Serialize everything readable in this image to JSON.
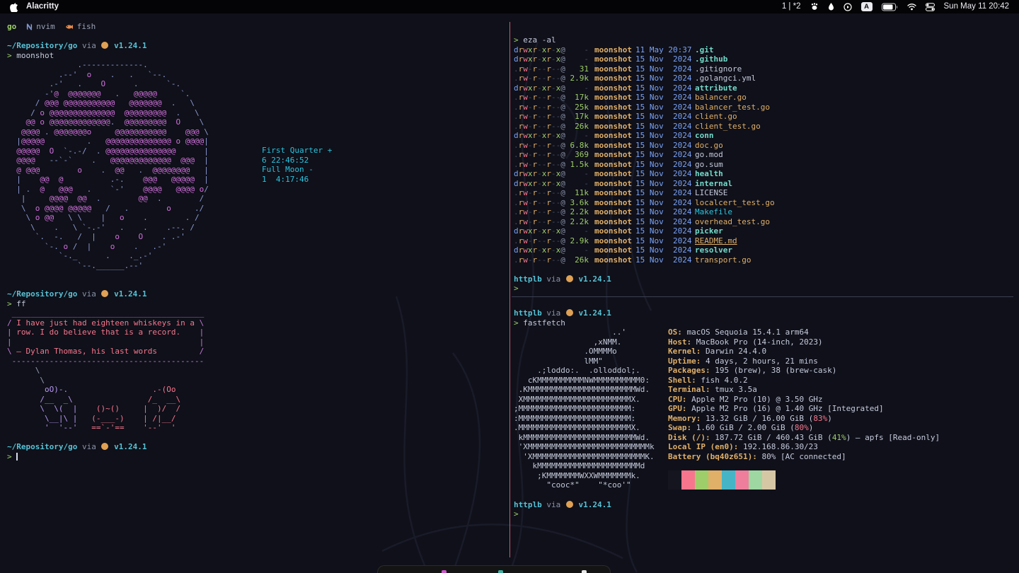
{
  "menubar": {
    "app_name": "Alacritty",
    "spaces_indicator": "1 | *2",
    "input_source": "A",
    "clock": "Sun May 11 20:42"
  },
  "tmux": {
    "windows": [
      {
        "label": "go",
        "active": true
      },
      {
        "label": "nvim",
        "active": false
      },
      {
        "label": "fish",
        "active": false
      }
    ]
  },
  "prompt": {
    "left_path": "~/Repository/go",
    "right_path": "httplb",
    "via": "via",
    "go_version": "v1.24.1",
    "symbol": ">"
  },
  "left_pane": {
    "cmd_moonshot": "moonshot",
    "moon_art": [
      "               .-------------.",
      "           .--'  o    .   .   `--.",
      "         .-'   .    O      .      `-.",
      "        -'@  @@@@@@@   .   @@@@@     `.",
      "      / @@@ @@@@@@@@@@@   @@@@@@@  .   \\",
      "     / o @@@@@@@@@@@@@@  @@@@@@@@@  .   \\",
      "    @@ o @@@@@@@@@@@@@.  @@@@@@@@@  O    \\",
      "   @@@@ . @@@@@@@o     @@@@@@@@@@@    @@@ \\",
      "  |@@@@@         .   @@@@@@@@@@@@@@ o @@@@|",
      "  @@@@@  O  `-.-/  . @@@@@@@@@@@@@@@      |",
      "  @@@@   --`-`    .   @@@@@@@@@@@@@  @@@  |",
      "  @ @@@        o    .  @@   .  @@@@@@@@   |",
      "  |    @@  @          .-.    @@@   @@@@@  |",
      "  | .  @   @@@   .    `-'    @@@@   @@@@ o/",
      "   |     @@@@  @@  .        @@  .        /",
      "   \\  o @@@@ @@@@@   /   .        o     ./",
      "    \\ o @@   \\ \\    |   o    .        . /",
      "     \\    .   \\ `-.-'   .    .    .--. /",
      "      `.  -.   /  |    o    O    . .-'",
      "        `-. o /  |    o    .   .-'",
      "           `-._      .    ._.-'",
      "               `--.______.--'"
    ],
    "moon_info": [
      "First Quarter +",
      "6 22:46:52",
      "Full Moon -",
      "1  4:17:46"
    ],
    "cmd_ff": "ff",
    "fortune": [
      " _________________________________________",
      "/ I have just had eighteen whiskeys in a \\",
      "| row. I do believe that is a record.    |",
      "|                                        |",
      "\\ — Dylan Thomas, his last words         /",
      " -----------------------------------------"
    ],
    "animal_art": [
      "      \\",
      "       \\",
      "        oO)-.                  .-(Oo",
      "       /__  _\\                /_  __\\",
      "       \\  \\(  |    ()~()     |  )/  /",
      "        \\__|\\ |   (-___-)    | /|__/",
      "        '  '--'   ==`-'==    '--'  '"
    ]
  },
  "right_top": {
    "cmd": "eza -al",
    "files": [
      {
        "perm": "drwxr-xr-x@",
        "size": "-",
        "user": "moonshot",
        "date": "11 May 20:37",
        "name": ".git",
        "type": "dir"
      },
      {
        "perm": "drwxr-xr-x@",
        "size": "-",
        "user": "moonshot",
        "date": "15 Nov  2024",
        "name": ".github",
        "type": "dir"
      },
      {
        "perm": ".rw-r--r--@",
        "size": "31",
        "user": "moonshot",
        "date": "15 Nov  2024",
        "name": ".gitignore",
        "type": "plain"
      },
      {
        "perm": ".rw-r--r--@",
        "size": "2.9k",
        "user": "moonshot",
        "date": "15 Nov  2024",
        "name": ".golangci.yml",
        "type": "plain"
      },
      {
        "perm": "drwxr-xr-x@",
        "size": "-",
        "user": "moonshot",
        "date": "15 Nov  2024",
        "name": "attribute",
        "type": "dir"
      },
      {
        "perm": ".rw-r--r--@",
        "size": "17k",
        "user": "moonshot",
        "date": "15 Nov  2024",
        "name": "balancer.go",
        "type": "go"
      },
      {
        "perm": ".rw-r--r--@",
        "size": "25k",
        "user": "moonshot",
        "date": "15 Nov  2024",
        "name": "balancer_test.go",
        "type": "go"
      },
      {
        "perm": ".rw-r--r--@",
        "size": "17k",
        "user": "moonshot",
        "date": "15 Nov  2024",
        "name": "client.go",
        "type": "go"
      },
      {
        "perm": ".rw-r--r--@",
        "size": "26k",
        "user": "moonshot",
        "date": "15 Nov  2024",
        "name": "client_test.go",
        "type": "go"
      },
      {
        "perm": "drwxr-xr-x@",
        "size": "-",
        "user": "moonshot",
        "date": "15 Nov  2024",
        "name": "conn",
        "type": "dir"
      },
      {
        "perm": ".rw-r--r--@",
        "size": "6.8k",
        "user": "moonshot",
        "date": "15 Nov  2024",
        "name": "doc.go",
        "type": "go"
      },
      {
        "perm": ".rw-r--r--@",
        "size": "369",
        "user": "moonshot",
        "date": "15 Nov  2024",
        "name": "go.mod",
        "type": "plain"
      },
      {
        "perm": ".rw-r--r--@",
        "size": "1.5k",
        "user": "moonshot",
        "date": "15 Nov  2024",
        "name": "go.sum",
        "type": "plain"
      },
      {
        "perm": "drwxr-xr-x@",
        "size": "-",
        "user": "moonshot",
        "date": "15 Nov  2024",
        "name": "health",
        "type": "dir"
      },
      {
        "perm": "drwxr-xr-x@",
        "size": "-",
        "user": "moonshot",
        "date": "15 Nov  2024",
        "name": "internal",
        "type": "dir"
      },
      {
        "perm": ".rw-r--r--@",
        "size": "11k",
        "user": "moonshot",
        "date": "15 Nov  2024",
        "name": "LICENSE",
        "type": "plain"
      },
      {
        "perm": ".rw-r--r--@",
        "size": "3.6k",
        "user": "moonshot",
        "date": "15 Nov  2024",
        "name": "localcert_test.go",
        "type": "go"
      },
      {
        "perm": ".rw-r--r--@",
        "size": "2.2k",
        "user": "moonshot",
        "date": "15 Nov  2024",
        "name": "Makefile",
        "type": "make"
      },
      {
        "perm": ".rw-r--r--@",
        "size": "2.2k",
        "user": "moonshot",
        "date": "15 Nov  2024",
        "name": "overhead_test.go",
        "type": "go"
      },
      {
        "perm": "drwxr-xr-x@",
        "size": "-",
        "user": "moonshot",
        "date": "15 Nov  2024",
        "name": "picker",
        "type": "dir"
      },
      {
        "perm": ".rw-r--r--@",
        "size": "2.9k",
        "user": "moonshot",
        "date": "15 Nov  2024",
        "name": "README.md",
        "type": "readme"
      },
      {
        "perm": "drwxr-xr-x@",
        "size": "-",
        "user": "moonshot",
        "date": "15 Nov  2024",
        "name": "resolver",
        "type": "dir"
      },
      {
        "perm": ".rw-r--r--@",
        "size": "26k",
        "user": "moonshot",
        "date": "15 Nov  2024",
        "name": "transport.go",
        "type": "go"
      }
    ]
  },
  "right_bottom": {
    "cmd": "fastfetch",
    "logo": [
      "                     ..'",
      "                 ,xNMM.",
      "               .OMMMMo",
      "               lMM\"",
      "     .;loddo:.  .olloddol;.",
      "   cKMMMMMMMMMMNWMMMMMMMMMM0:",
      " .KMMMMMMMMMMMMMMMMMMMMMMMWd.",
      " XMMMMMMMMMMMMMMMMMMMMMMMX.",
      ";MMMMMMMMMMMMMMMMMMMMMMMM:",
      ":MMMMMMMMMMMMMMMMMMMMMMMM:",
      ".MMMMMMMMMMMMMMMMMMMMMMMMX.",
      " kMMMMMMMMMMMMMMMMMMMMMMMMWd.",
      " 'XMMMMMMMMMMMMMMMMMMMMMMMMMMk",
      "  'XMMMMMMMMMMMMMMMMMMMMMMMMK.",
      "    kMMMMMMMMMMMMMMMMMMMMMMd",
      "     ;KMMMMMMMWXXWMMMMMMMk.",
      "       \"cooc*\"    \"*coo'\""
    ],
    "info": [
      {
        "label": "OS",
        "parts": [
          {
            "t": "macOS Sequoia 15.4.1 arm64"
          }
        ]
      },
      {
        "label": "Host",
        "parts": [
          {
            "t": "MacBook Pro (14-inch, 2023)"
          }
        ]
      },
      {
        "label": "Kernel",
        "parts": [
          {
            "t": "Darwin 24.4.0"
          }
        ]
      },
      {
        "label": "Uptime",
        "parts": [
          {
            "t": "4 days, 2 hours, 21 mins"
          }
        ]
      },
      {
        "label": "Packages",
        "parts": [
          {
            "t": "195 (brew), 38 (brew-cask)"
          }
        ]
      },
      {
        "label": "Shell",
        "parts": [
          {
            "t": "fish 4.0.2"
          }
        ]
      },
      {
        "label": "Terminal",
        "parts": [
          {
            "t": "tmux 3.5a"
          }
        ]
      },
      {
        "label": "CPU",
        "parts": [
          {
            "t": "Apple M2 Pro (10) @ 3.50 GHz"
          }
        ]
      },
      {
        "label": "GPU",
        "parts": [
          {
            "t": "Apple M2 Pro (16) @ 1.40 GHz [Integrated]"
          }
        ]
      },
      {
        "label": "Memory",
        "parts": [
          {
            "t": "13.32 GiB / 16.00 GiB ("
          },
          {
            "t": "83%",
            "c": "red"
          },
          {
            "t": ")"
          }
        ]
      },
      {
        "label": "Swap",
        "parts": [
          {
            "t": "1.60 GiB / 2.00 GiB ("
          },
          {
            "t": "80%",
            "c": "red"
          },
          {
            "t": ")"
          }
        ]
      },
      {
        "label": "Disk (/)",
        "parts": [
          {
            "t": "187.72 GiB / 460.43 GiB ("
          },
          {
            "t": "41%",
            "c": "greenv"
          },
          {
            "t": ") — apfs [Read-only]"
          }
        ]
      },
      {
        "label": "Local IP (en0)",
        "parts": [
          {
            "t": "192.168.86.30/23"
          }
        ]
      },
      {
        "label": "Battery (bq40z651)",
        "parts": [
          {
            "t": "80% [AC connected]"
          }
        ]
      }
    ],
    "palette": [
      "#14151f",
      "#f7768e",
      "#9ece6a",
      "#e0af68",
      "#45b5c6",
      "#ef7e9d",
      "#9ed7a2",
      "#d6c7a4"
    ]
  },
  "colors": {
    "background": "#0f1019",
    "active_pane_border": "#c75c74",
    "inactive_pane_border": "#3a3f52",
    "prompt_cyan": "#56c2d6",
    "green": "#9ece6a",
    "yellow": "#e0af68",
    "red": "#f7768e",
    "magenta": "#c678dd",
    "blue": "#7aa2f7",
    "teal": "#73daca"
  }
}
